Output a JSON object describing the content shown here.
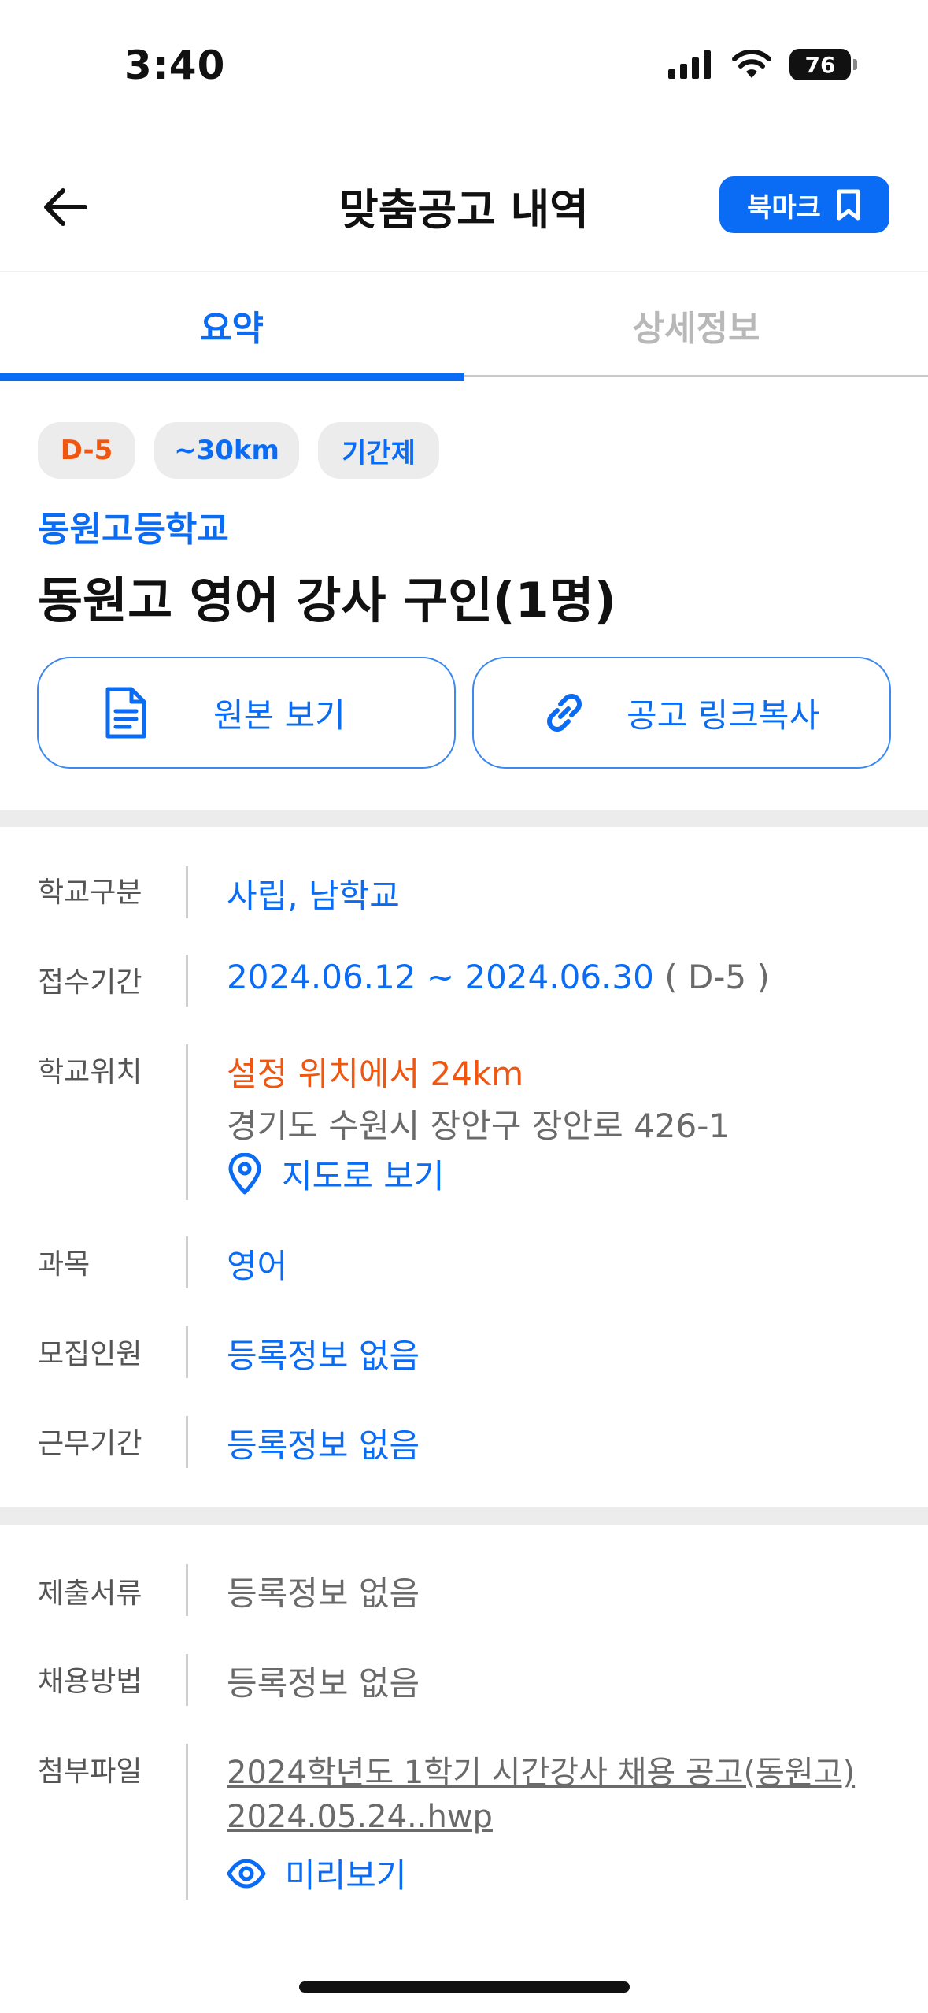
{
  "status_bar": {
    "time": "3:40",
    "battery": "76"
  },
  "header": {
    "title": "맞춤공고 내역",
    "bookmark_label": "북마크"
  },
  "tabs": [
    {
      "label": "요약",
      "active": true
    },
    {
      "label": "상세정보",
      "active": false
    }
  ],
  "chips": [
    {
      "label": "D-5",
      "color": "#f0560f"
    },
    {
      "label": "~30km",
      "color": "#0a6cf5"
    },
    {
      "label": "기간제",
      "color": "#0a6cf5"
    }
  ],
  "school_name": "동원고등학교",
  "job_title": "동원고 영어 강사 구인(1명)",
  "actions": {
    "view_original": "원본 보기",
    "copy_link": "공고 링크복사"
  },
  "info": {
    "school_type": {
      "label": "학교구분",
      "value": "사립, 남학교"
    },
    "period": {
      "label": "접수기간",
      "value": "2024.06.12 ~ 2024.06.30",
      "dday": "( D-5 )"
    },
    "location": {
      "label": "학교위치",
      "distance": "설정 위치에서 24km",
      "address": "경기도 수원시 장안구 장안로 426-1",
      "map_link": "지도로 보기"
    },
    "subject": {
      "label": "과목",
      "value": "영어"
    },
    "recruits": {
      "label": "모집인원",
      "value": "등록정보 없음"
    },
    "work_period": {
      "label": "근무기간",
      "value": "등록정보 없음"
    }
  },
  "docs": {
    "documents": {
      "label": "제출서류",
      "value": "등록정보 없음"
    },
    "method": {
      "label": "채용방법",
      "value": "등록정보 없음"
    },
    "attachment": {
      "label": "첨부파일",
      "file_line1": "2024학년도 1학기 시간강사 채용 공고(동원고)",
      "file_line2": "2024.05.24..hwp",
      "preview": "미리보기"
    }
  },
  "colors": {
    "accent": "#0a6cf5",
    "warning": "#f0560f",
    "chip_bg": "#ececec"
  }
}
